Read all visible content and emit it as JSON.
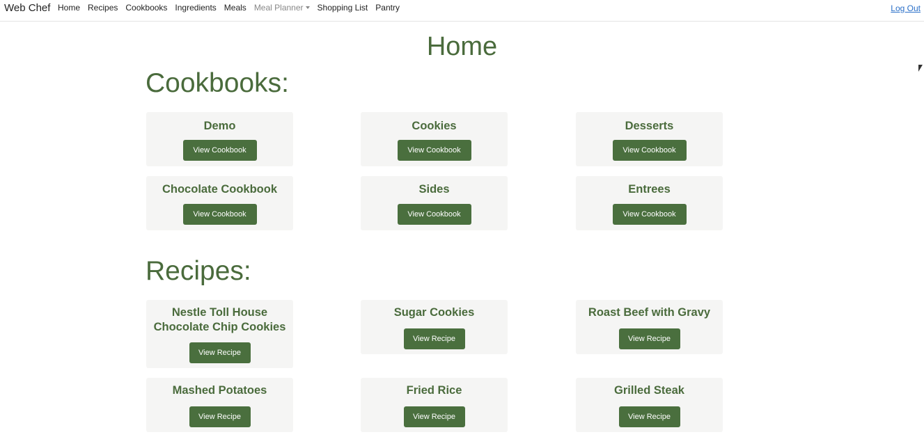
{
  "nav": {
    "brand": "Web Chef",
    "links": [
      "Home",
      "Recipes",
      "Cookbooks",
      "Ingredients",
      "Meals",
      "Meal Planner",
      "Shopping List",
      "Pantry"
    ],
    "logout": "Log Out"
  },
  "page": {
    "title": "Home",
    "cookbooks_heading": "Cookbooks:",
    "recipes_heading": "Recipes:"
  },
  "cookbooks": [
    {
      "name": "Demo",
      "button": "View Cookbook"
    },
    {
      "name": "Cookies",
      "button": "View Cookbook"
    },
    {
      "name": "Desserts",
      "button": "View Cookbook"
    },
    {
      "name": "Chocolate Cookbook",
      "button": "View Cookbook"
    },
    {
      "name": "Sides",
      "button": "View Cookbook"
    },
    {
      "name": "Entrees",
      "button": "View Cookbook"
    }
  ],
  "recipes": [
    {
      "name": "Nestle Toll House Chocolate Chip Cookies",
      "button": "View Recipe"
    },
    {
      "name": "Sugar Cookies",
      "button": "View Recipe"
    },
    {
      "name": "Roast Beef with Gravy",
      "button": "View Recipe"
    },
    {
      "name": "Mashed Potatoes",
      "button": "View Recipe"
    },
    {
      "name": "Fried Rice",
      "button": "View Recipe"
    },
    {
      "name": "Grilled Steak",
      "button": "View Recipe"
    }
  ],
  "colors": {
    "accent": "#4a6f3e",
    "heading": "#4a6b3c",
    "card_bg": "#f5f5f4",
    "link": "#2a6fc8"
  }
}
